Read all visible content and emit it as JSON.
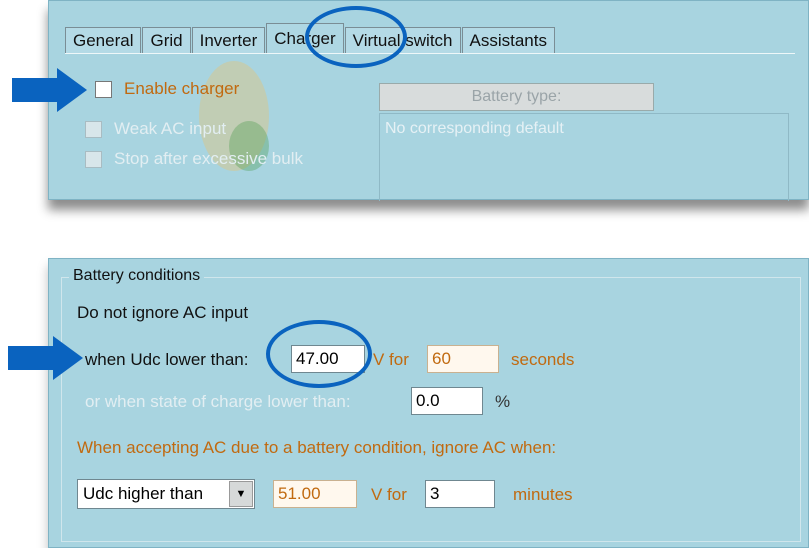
{
  "tabs": [
    {
      "label": "General"
    },
    {
      "label": "Grid"
    },
    {
      "label": "Inverter"
    },
    {
      "label": "Charger"
    },
    {
      "label": "Virtual switch"
    },
    {
      "label": "Assistants"
    }
  ],
  "active_tab": "Charger",
  "charger": {
    "enable_label": "Enable charger",
    "enable_checked": false,
    "weak_ac_label": "Weak AC input",
    "stop_bulk_label": "Stop after excessive bulk",
    "battery_type_button": "Battery type:",
    "default_text": "No corresponding default"
  },
  "battery_conditions": {
    "legend": "Battery conditions",
    "line1": "Do not ignore AC input",
    "udc_label": "when Udc lower than:",
    "udc_value": "47.00",
    "v_for": "V for",
    "seconds_value": "60",
    "seconds_label": "seconds",
    "soc_label": "or when state of charge lower than:",
    "soc_value": "0.0",
    "percent": "%",
    "accept_label": "When accepting AC due to a battery condition, ignore AC when:",
    "select_value": "Udc higher than",
    "higher_value": "51.00",
    "v_for2": "V  for",
    "minutes_value": "3",
    "minutes_label": "minutes"
  },
  "colors": {
    "panel": "#a8d4e0",
    "accent": "#0a63bf",
    "label_orange": "#c16a10"
  }
}
